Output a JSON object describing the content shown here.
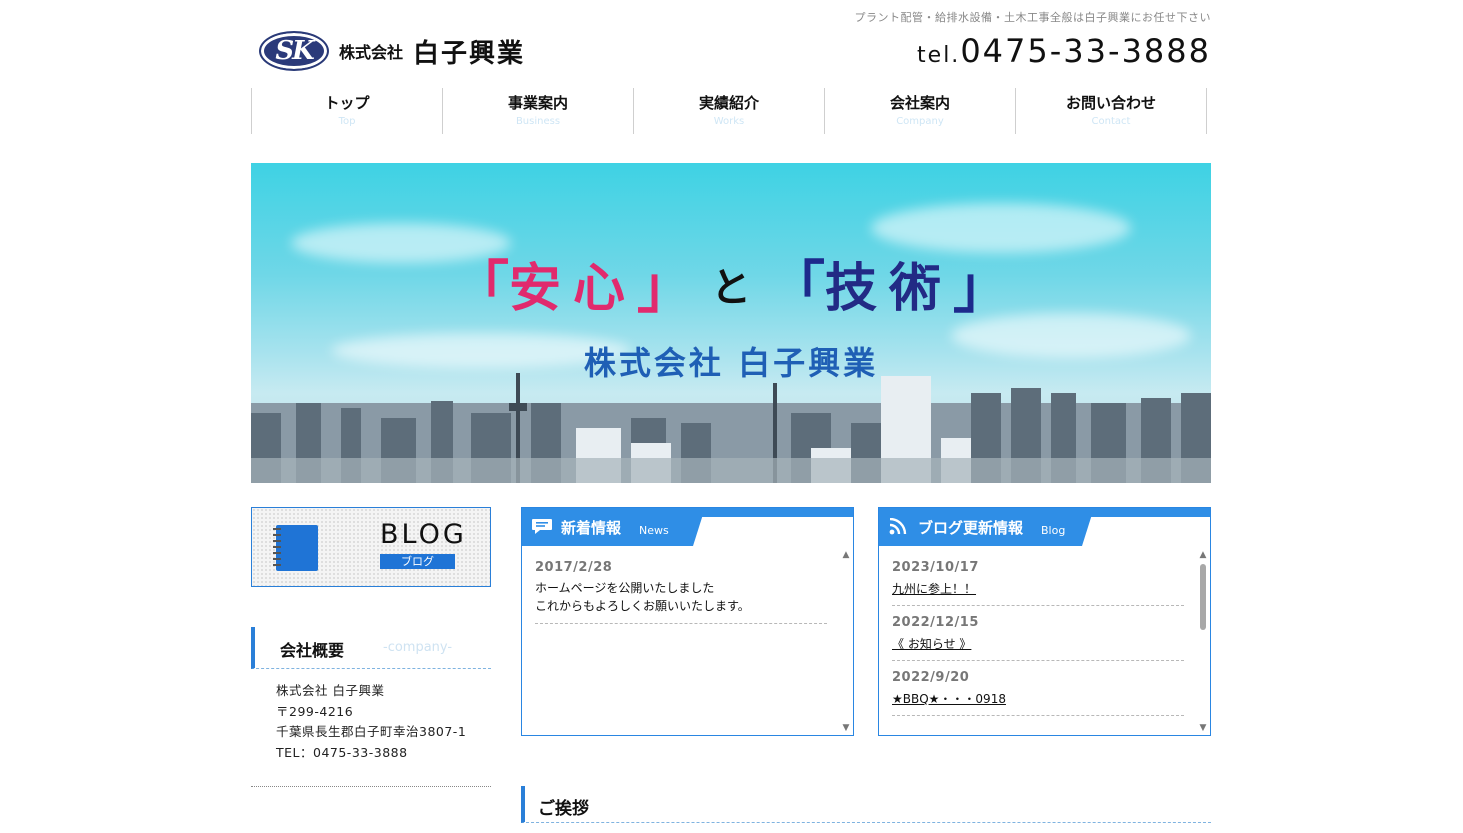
{
  "header": {
    "tagline": "プラント配管・給排水設備・土木工事全般は白子興業にお任せ下さい",
    "logo_mark": "SK",
    "logo_kk": "株式会社",
    "logo_name": "白子興業",
    "tel_prefix": "tel.",
    "tel_number": "0475-33-3888"
  },
  "nav": {
    "items": [
      {
        "jp": "トップ",
        "en": "Top"
      },
      {
        "jp": "事業案内",
        "en": "Business"
      },
      {
        "jp": "実績紹介",
        "en": "Works"
      },
      {
        "jp": "会社案内",
        "en": "Company"
      },
      {
        "jp": "お問い合わせ",
        "en": "Contact"
      }
    ]
  },
  "hero": {
    "open1": "「",
    "word1": "安心",
    "close1": "」",
    "connector": "と",
    "open2": "「",
    "word2": "技術",
    "close2": "」",
    "subtitle": "株式会社 白子興業"
  },
  "blog_banner": {
    "title": "BLOG",
    "subtitle": "ブログ"
  },
  "company": {
    "heading": "会社概要",
    "heading_en": "-company-",
    "lines": [
      "株式会社 白子興業",
      "〒299-4216",
      "千葉県長生郡白子町幸治3807-1",
      "TEL：0475-33-3888"
    ]
  },
  "news": {
    "title": "新着情報",
    "title_en": "News",
    "entries": [
      {
        "date": "2017/2/28",
        "text1": "ホームページを公開いたしました",
        "text2": "これからもよろしくお願いいたします。"
      }
    ]
  },
  "blog_updates": {
    "title": "ブログ更新情報",
    "title_en": "Blog",
    "entries": [
      {
        "date": "2023/10/17",
        "link": "九州に参上！！"
      },
      {
        "date": "2022/12/15",
        "link": "《 お知らせ 》"
      },
      {
        "date": "2022/9/20",
        "link": "★BBQ★・・・0918"
      }
    ]
  },
  "greeting": {
    "heading": "ご挨拶"
  },
  "colors": {
    "accent": "#2f8ee6",
    "pink": "#e12a6d",
    "navy": "#222a85"
  }
}
